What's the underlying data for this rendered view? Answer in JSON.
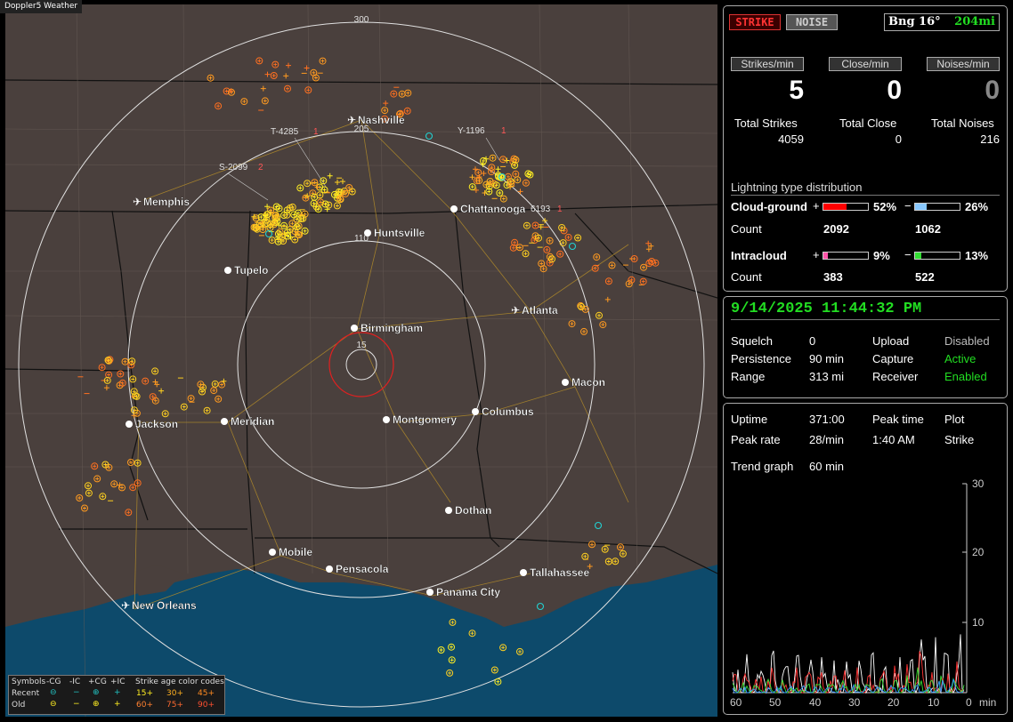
{
  "app": {
    "title": "Doppler5 Weather"
  },
  "map": {
    "cities": [
      {
        "name": "Nashville",
        "airport": true
      },
      {
        "name": "Memphis",
        "airport": true
      },
      {
        "name": "Chattanooga",
        "airport": false
      },
      {
        "name": "Huntsville",
        "airport": false
      },
      {
        "name": "Tupelo",
        "airport": false
      },
      {
        "name": "Atlanta",
        "airport": true
      },
      {
        "name": "Birmingham",
        "airport": false
      },
      {
        "name": "Macon",
        "airport": false
      },
      {
        "name": "Jackson",
        "airport": false
      },
      {
        "name": "Meridian",
        "airport": false
      },
      {
        "name": "Montgomery",
        "airport": false
      },
      {
        "name": "Columbus",
        "airport": false
      },
      {
        "name": "Dothan",
        "airport": false
      },
      {
        "name": "Mobile",
        "airport": false
      },
      {
        "name": "Pensacola",
        "airport": false
      },
      {
        "name": "Tallahassee",
        "airport": false
      },
      {
        "name": "Panama City",
        "airport": false
      },
      {
        "name": "New Orleans",
        "airport": true
      }
    ],
    "range_labels": [
      "300",
      "205",
      "110",
      "15"
    ],
    "storm_ids": [
      {
        "id": "T-4285",
        "n": "1"
      },
      {
        "id": "Y-1196",
        "n": "1"
      },
      {
        "id": "S-2099",
        "n": "2"
      },
      {
        "id": "6193",
        "n": "1"
      }
    ]
  },
  "legend": {
    "symbols": "Symbols",
    "neg_cg": "-CG",
    "neg_ic": "-IC",
    "pos_cg": "+CG",
    "pos_ic": "+IC",
    "age_title": "Strike age color codes",
    "recent": "Recent",
    "old": "Old",
    "ages_recent": [
      "15+",
      "30+",
      "45+"
    ],
    "ages_old": [
      "60+",
      "75+",
      "90+"
    ]
  },
  "panel": {
    "strike_button": "STRIKE",
    "noise_button": "NOISE",
    "bearing": "Bng 16°",
    "distance": "204mi",
    "rates": [
      {
        "label": "Strikes/min",
        "value": "5"
      },
      {
        "label": "Close/min",
        "value": "0"
      },
      {
        "label": "Noises/min",
        "value": "0"
      }
    ],
    "totals": [
      {
        "label": "Total Strikes",
        "value": "4059"
      },
      {
        "label": "Total Close",
        "value": "0"
      },
      {
        "label": "Total Noises",
        "value": "216"
      }
    ],
    "distribution_title": "Lightning type distribution",
    "cloud_ground": {
      "label": "Cloud-ground",
      "pos_pct": "52%",
      "neg_pct": "26%",
      "pos_frac": 0.52,
      "neg_frac": 0.26,
      "count_label": "Count",
      "pos_count": "2092",
      "neg_count": "1062"
    },
    "intracloud": {
      "label": "Intracloud",
      "pos_pct": "9%",
      "neg_pct": "13%",
      "pos_frac": 0.09,
      "neg_frac": 0.13,
      "count_label": "Count",
      "pos_count": "383",
      "neg_count": "522"
    },
    "colors": {
      "cg_pos": "#ff0000",
      "cg_neg": "#88c8ff",
      "ic_pos": "#ff55aa",
      "ic_neg": "#33dd33",
      "good": "#22dd22"
    }
  },
  "status": {
    "datetime": "9/14/2025 11:44:32 PM",
    "squelch_label": "Squelch",
    "squelch": "0",
    "persistence_label": "Persistence",
    "persistence": "90 min",
    "range_label": "Range",
    "range": "313 mi",
    "upload_label": "Upload",
    "upload": "Disabled",
    "capture_label": "Capture",
    "capture": "Active",
    "receiver_label": "Receiver",
    "receiver": "Enabled"
  },
  "trend": {
    "uptime_label": "Uptime",
    "uptime": "371:00",
    "peak_time_label": "Peak time",
    "peak_time": "1:40 AM",
    "plot_label": "Plot",
    "plot": "Strike",
    "peak_rate_label": "Peak rate",
    "peak_rate": "28/min",
    "graph_label": "Trend graph",
    "graph": "60 min",
    "y_ticks": [
      "30",
      "20",
      "10"
    ],
    "x_ticks": [
      "60",
      "50",
      "40",
      "30",
      "20",
      "10",
      "0"
    ],
    "x_unit": "min"
  }
}
